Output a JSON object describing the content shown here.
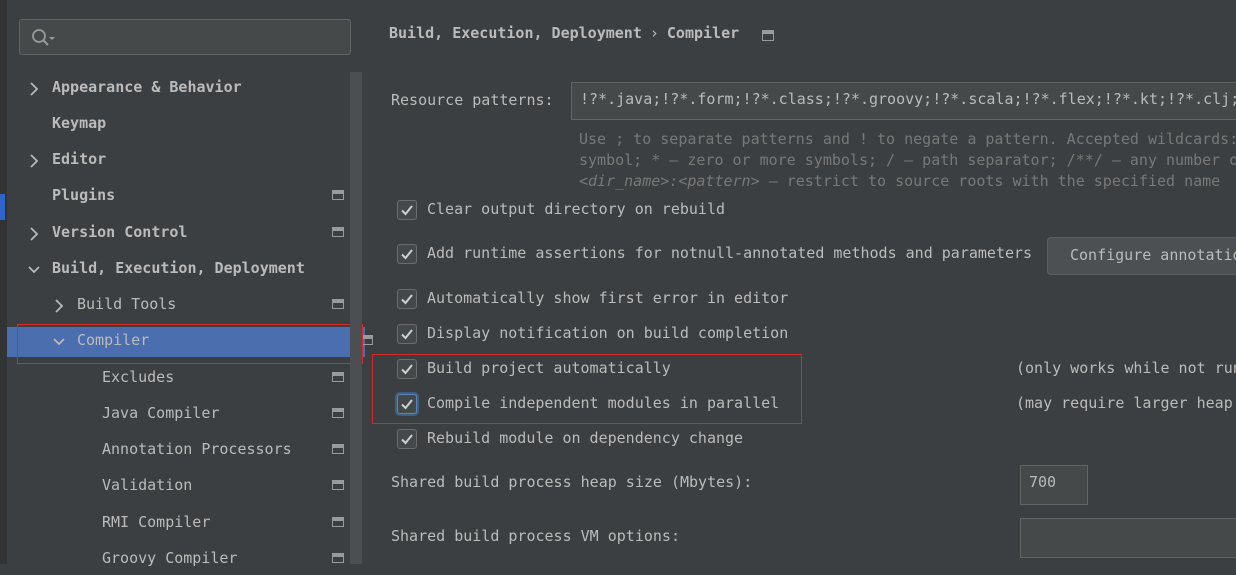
{
  "search": {
    "placeholder": ""
  },
  "tree": [
    {
      "label": "Appearance & Behavior",
      "bold": true,
      "chevron": "right",
      "indent": 0,
      "page_icon": false
    },
    {
      "label": "Keymap",
      "bold": true,
      "chevron": "none",
      "indent": 0,
      "page_icon": false
    },
    {
      "label": "Editor",
      "bold": true,
      "chevron": "right",
      "indent": 0,
      "page_icon": false
    },
    {
      "label": "Plugins",
      "bold": true,
      "chevron": "none",
      "indent": 0,
      "page_icon": true
    },
    {
      "label": "Version Control",
      "bold": true,
      "chevron": "right",
      "indent": 0,
      "page_icon": true
    },
    {
      "label": "Build, Execution, Deployment",
      "bold": true,
      "chevron": "down",
      "indent": 0,
      "page_icon": false
    },
    {
      "label": "Build Tools",
      "bold": false,
      "chevron": "right",
      "indent": 1,
      "page_icon": true
    },
    {
      "label": "Compiler",
      "bold": false,
      "chevron": "down",
      "indent": 1,
      "page_icon": true,
      "selected": true
    },
    {
      "label": "Excludes",
      "bold": false,
      "chevron": "none",
      "indent": 2,
      "page_icon": true
    },
    {
      "label": "Java Compiler",
      "bold": false,
      "chevron": "none",
      "indent": 2,
      "page_icon": true
    },
    {
      "label": "Annotation Processors",
      "bold": false,
      "chevron": "none",
      "indent": 2,
      "page_icon": true
    },
    {
      "label": "Validation",
      "bold": false,
      "chevron": "none",
      "indent": 2,
      "page_icon": true
    },
    {
      "label": "RMI Compiler",
      "bold": false,
      "chevron": "none",
      "indent": 2,
      "page_icon": true
    },
    {
      "label": "Groovy Compiler",
      "bold": false,
      "chevron": "none",
      "indent": 2,
      "page_icon": true
    }
  ],
  "breadcrumb": {
    "parent": "Build, Execution, Deployment",
    "separator": "›",
    "current": "Compiler"
  },
  "resource_patterns": {
    "label": "Resource patterns:",
    "value": "!?*.java;!?*.form;!?*.class;!?*.groovy;!?*.scala;!?*.flex;!?*.kt;!?*.clj;",
    "hint_line1": "Use ; to separate patterns and ! to negate a pattern. Accepted wildcards:",
    "hint_line2": "symbol; * — zero or more symbols; / — path separator; /**/ — any number o",
    "hint_line3_italic": "<dir_name>:<pattern>",
    "hint_line3_rest": " — restrict to source roots with the specified name"
  },
  "checkboxes": [
    {
      "label": "Clear output directory on rebuild",
      "checked": true
    },
    {
      "label": "Add runtime assertions for notnull-annotated methods and parameters",
      "checked": true
    },
    {
      "label": "Automatically show first error in editor",
      "checked": true
    },
    {
      "label": "Display notification on build completion",
      "checked": true
    },
    {
      "label": "Build project automatically",
      "checked": true,
      "note": "(only works while not run"
    },
    {
      "label": "Compile independent modules in parallel",
      "checked": true,
      "focused": true,
      "note": "(may require larger heap"
    },
    {
      "label": "Rebuild module on dependency change",
      "checked": true
    }
  ],
  "configure_button": "Configure annotatio",
  "heap": {
    "label": "Shared build process heap size (Mbytes):",
    "value": "700"
  },
  "vm_options": {
    "label": "Shared build process VM options:",
    "value": ""
  },
  "colors": {
    "background": "#3c3f41",
    "selection": "#4b6eaf",
    "highlight": "#d42a2a"
  }
}
